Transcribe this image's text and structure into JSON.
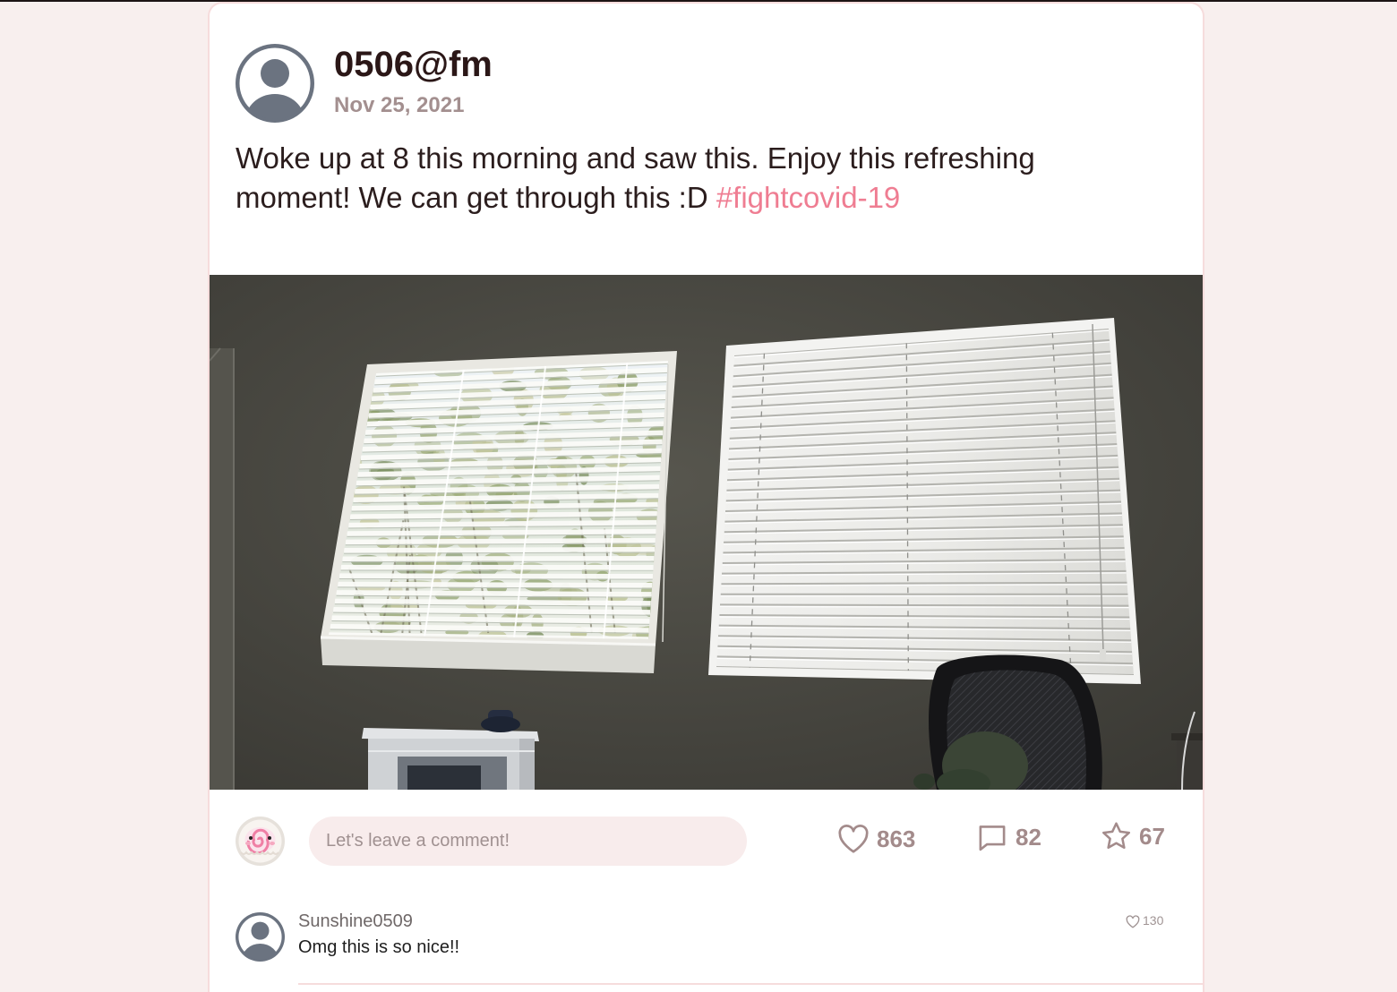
{
  "post": {
    "author": "0506@fm",
    "date": "Nov 25, 2021",
    "text": "Woke up at 8 this morning and saw this. Enjoy this refreshing moment! We can get through this :D",
    "hashtag": "#fightcovid-19",
    "avatar_icon": "user-avatar-icon"
  },
  "composer": {
    "placeholder": "Let's leave a comment!",
    "avatar_icon": "current-user-avatar"
  },
  "actions": {
    "likes": {
      "icon": "heart-icon",
      "count": 863
    },
    "comments": {
      "icon": "comment-icon",
      "count": 82
    },
    "favorites": {
      "icon": "star-icon",
      "count": 67
    }
  },
  "comments": [
    {
      "author": "Sunshine0509",
      "text": "Omg this is so nice!!",
      "likes": 130,
      "avatar_icon": "user-avatar-icon",
      "like_icon": "heart-icon"
    }
  ],
  "colors": {
    "page_background": "#f8efee",
    "card_border": "#f6dcdc",
    "text": "#2b1d1d",
    "muted": "#a38b8b",
    "hashtag": "#ef7d92",
    "avatar_gray": "#6b7380",
    "input_background": "#f8ecec"
  }
}
